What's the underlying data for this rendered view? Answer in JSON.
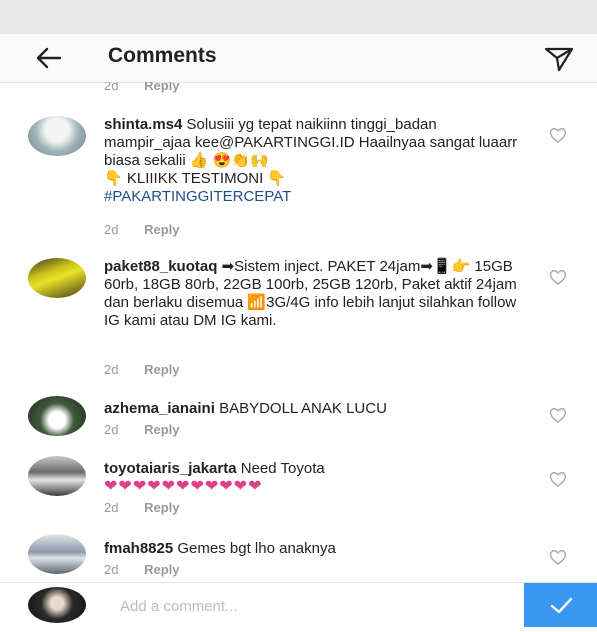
{
  "header": {
    "title": "Comments",
    "back_icon": "arrow-left-icon",
    "send_icon": "paper-plane-icon"
  },
  "top_meta": {
    "time": "2d",
    "reply": "Reply"
  },
  "comments": [
    {
      "username": "shinta.ms4",
      "text": "Solusiii yg tepat naikiinn tinggi_badan mampir_ajaa kee@PAKARTINGGI.ID Haailnyaa sangat luaarr biasa sekalii 👍 😍👏🙌",
      "line2": "👇 KLIIIKK TESTIMONI 👇",
      "hashtag": "#PAKARTINGGITERCEPAT",
      "time": "2d",
      "reply": "Reply"
    },
    {
      "username": "paket88_kuotaq",
      "text": "➡Sistem inject. PAKET 24jam➡📱👉 15GB 60rb, 18GB 80rb, 22GB 100rb, 25GB 120rb, Paket aktif 24jam dan berlaku disemua 📶3G/4G info lebih lanjut silahkan follow IG kami atau DM IG kami.",
      "time": "2d",
      "reply": "Reply"
    },
    {
      "username": "azhema_ianaini",
      "text": "BABYDOLL ANAK LUCU",
      "time": "2d",
      "reply": "Reply"
    },
    {
      "username": "toyotaiaris_jakarta",
      "text": "Need Toyota",
      "hearts": "❤❤❤❤❤❤❤❤❤❤❤",
      "time": "2d",
      "reply": "Reply"
    },
    {
      "username": "fmah8825",
      "text": "Gemes bgt lho anaknya",
      "time": "2d",
      "reply": "Reply"
    }
  ],
  "composer": {
    "placeholder": "Add a comment...",
    "post_icon": "checkmark-icon"
  },
  "colors": {
    "accent": "#3897f0",
    "hashtag": "#1e4d8c",
    "muted": "#9a9a9a"
  }
}
